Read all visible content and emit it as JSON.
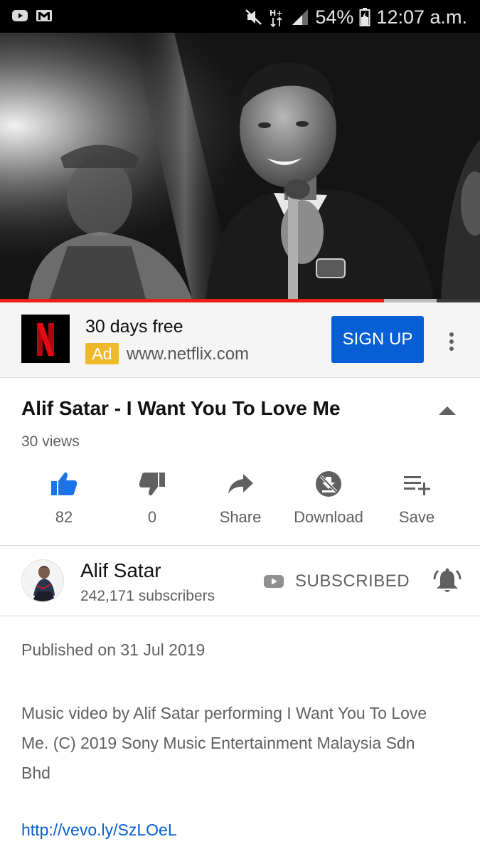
{
  "status_bar": {
    "left_icons": [
      "youtube-notification-icon",
      "gmail-notification-icon"
    ],
    "right_icons": [
      "mute-icon",
      "network-hplus-icon",
      "signal-icon",
      "battery-icon"
    ],
    "network": "H+",
    "battery": "54%",
    "time": "12:07 a.m."
  },
  "video": {
    "progress_percent": 80,
    "buffer_percent": 91
  },
  "ad": {
    "logo_letter": "N",
    "title": "30 days free",
    "badge": "Ad",
    "url": "www.netflix.com",
    "button": "SIGN UP"
  },
  "title": "Alif Satar - I Want You To Love Me",
  "views": "30 views",
  "actions": {
    "like": "82",
    "dislike": "0",
    "share": "Share",
    "download": "Download",
    "save": "Save"
  },
  "channel": {
    "name": "Alif Satar",
    "subscribers": "242,171 subscribers",
    "subscribe_label": "SUBSCRIBED"
  },
  "description": {
    "published": "Published on 31 Jul 2019",
    "text": "Music video by Alif Satar performing I Want You To Love Me. (C) 2019 Sony Music Entertainment Malaysia Sdn Bhd",
    "link": "http://vevo.ly/SzLOeL"
  },
  "colors": {
    "like_active": "#1a73e8",
    "ad_badge": "#f0b92b",
    "sign_up_button": "#065fd4",
    "progress": "#e62117",
    "netflix_red": "#e50914"
  }
}
